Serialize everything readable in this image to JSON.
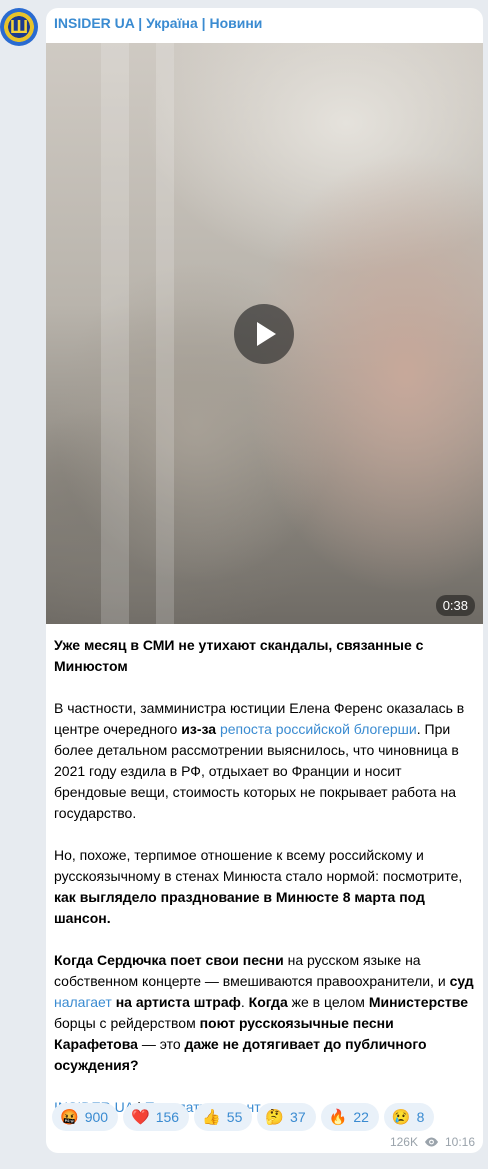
{
  "channel": {
    "name": "INSIDER UA | Україна | Новини"
  },
  "video": {
    "duration": "0:38"
  },
  "post": {
    "p1": "Уже месяц в СМИ не утихают скандалы, связанные с Минюстом",
    "p2_a": "В частности, замминистра юстиции Елена Ференс оказалась в центре очередного ",
    "p2_b": "из-за",
    "p2_link": "репоста российской блогерши",
    "p2_c": ". При более детальном рассмотрении выяснилось, что чиновница в 2021 году ездила в РФ, отдыхает во Франции и носит брендовые вещи, стоимость которых не покрывает работа на государство.",
    "p3_a": "Но, похоже, терпимое отношение к всему российскому и русскоязычному в стенах Минюста стало нормой: посмотрите, ",
    "p3_b": "как выглядело празднование в Минюсте 8 марта под шансон.",
    "p4_a": "Когда Сердючка поет свои песни",
    "p4_b": " на русском языке на собственном концерте — вмешиваются правоохранители, и ",
    "p4_c": "суд",
    "p4_link": "налагает",
    "p4_d": "на артиста штраф",
    "p4_e": ". ",
    "p4_f": "Когда",
    "p4_g": " же в целом ",
    "p4_h": "Министерстве",
    "p4_i": " борцы с рейдерством ",
    "p4_j": "поют русскоязычные песни Карафетова",
    "p4_k": " — это ",
    "p4_l": "даже не дотягивает до публичного осуждения?",
    "footer_link1": "INSIDER UA",
    "footer_sep": " | ",
    "footer_link2": "Прислать контент"
  },
  "reactions": [
    {
      "emoji": "🤬",
      "count": "900"
    },
    {
      "emoji": "❤️",
      "count": "156"
    },
    {
      "emoji": "👍",
      "count": "55"
    },
    {
      "emoji": "🤔",
      "count": "37"
    },
    {
      "emoji": "🔥",
      "count": "22"
    },
    {
      "emoji": "😢",
      "count": "8"
    }
  ],
  "meta": {
    "views": "126K",
    "time": "10:16"
  },
  "icons": {
    "eye": "eye-icon",
    "play": "play-icon"
  }
}
